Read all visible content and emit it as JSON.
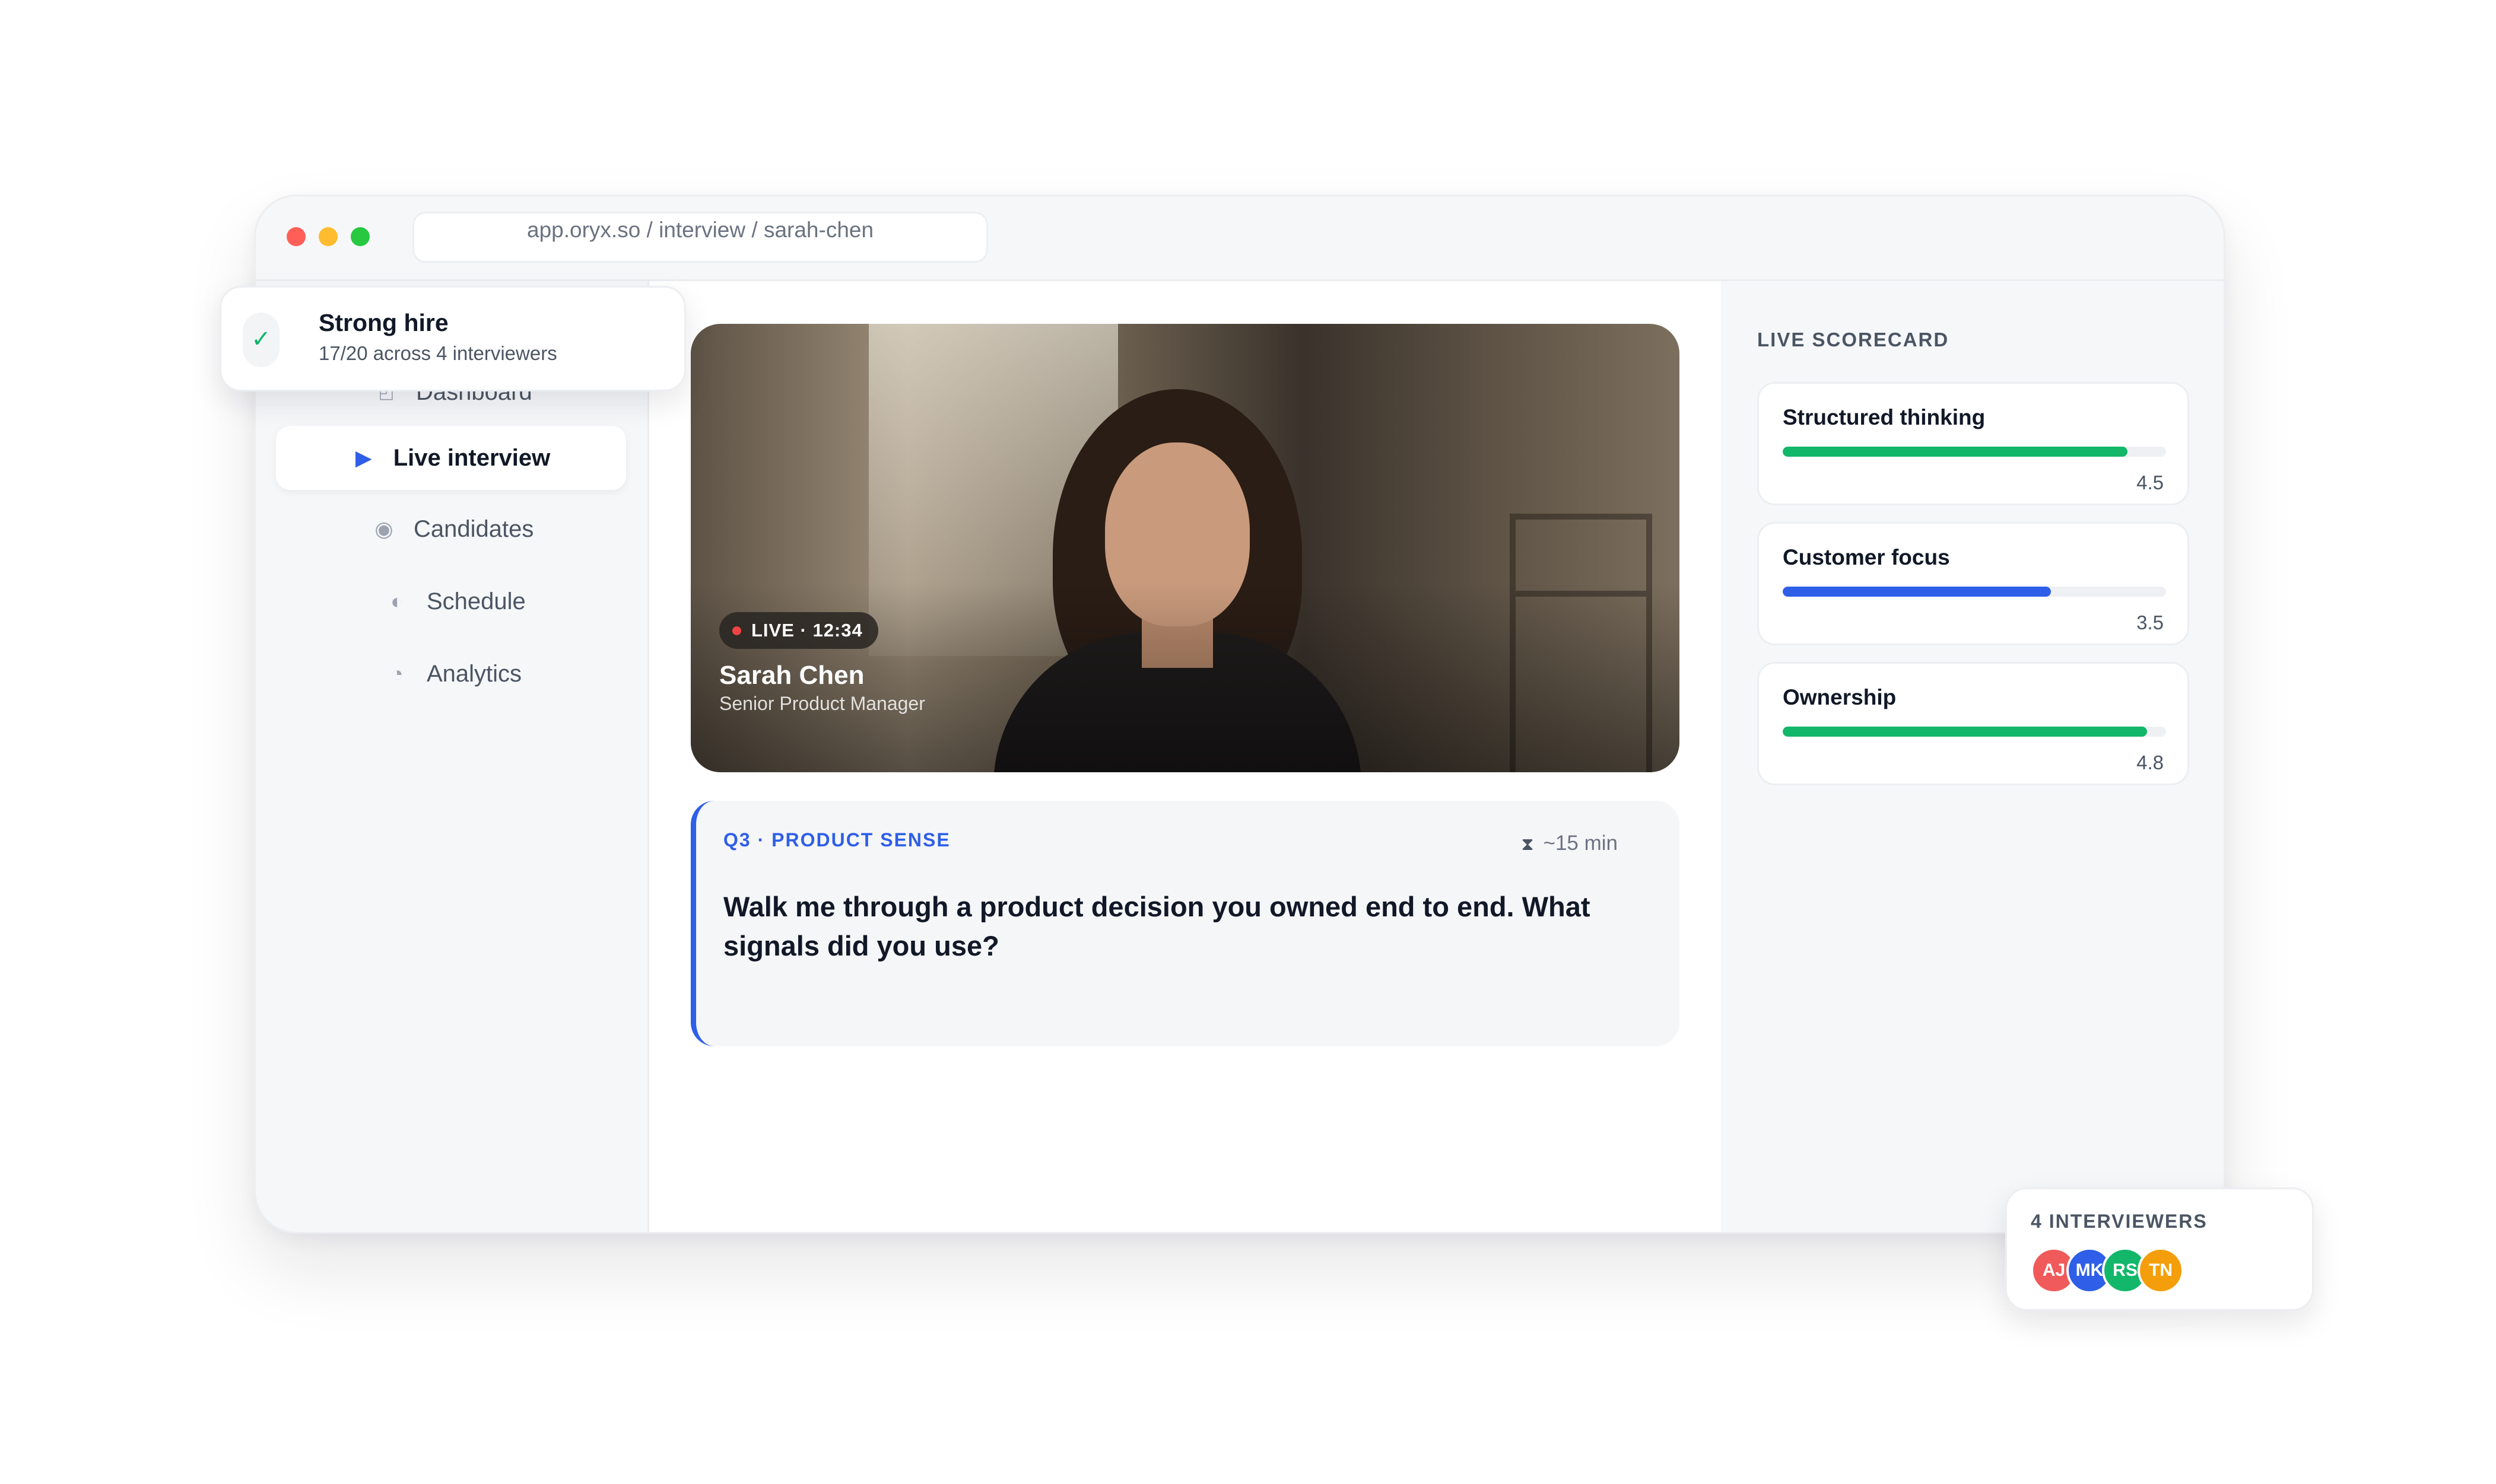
{
  "browser": {
    "url": "app.oryx.so / interview / sarah-chen"
  },
  "sidebar": {
    "items": [
      {
        "label": "Dashboard",
        "icon": "dashboard-icon"
      },
      {
        "label": "Live interview",
        "icon": "play-icon",
        "active": true
      },
      {
        "label": "Candidates",
        "icon": "candidates-icon"
      },
      {
        "label": "Schedule",
        "icon": "schedule-icon"
      },
      {
        "label": "Analytics",
        "icon": "analytics-icon"
      }
    ]
  },
  "video": {
    "live_badge": "LIVE · 12:34",
    "candidate_name": "Sarah Chen",
    "candidate_role": "Senior Product Manager"
  },
  "question": {
    "tag": "Q3 · PRODUCT SENSE",
    "duration": "~15 min",
    "text": "Walk me through a product decision you owned end to end. What signals did you use?"
  },
  "scorecard": {
    "title": "LIVE SCORECARD",
    "items": [
      {
        "label": "Structured thinking",
        "value": "4.5",
        "fraction": 0.9,
        "color": "#12b76a"
      },
      {
        "label": "Customer focus",
        "value": "3.5",
        "fraction": 0.7,
        "color": "#2f5fe8"
      },
      {
        "label": "Ownership",
        "value": "4.8",
        "fraction": 0.95,
        "color": "#12b76a"
      }
    ]
  },
  "hire_card": {
    "title": "Strong hire",
    "subtitle": "17/20 across 4 interviewers"
  },
  "interviewers": {
    "title": "4 INTERVIEWERS",
    "avatars": [
      {
        "initials": "AJ",
        "color": "#f05a5a"
      },
      {
        "initials": "MK",
        "color": "#2f5fe8"
      },
      {
        "initials": "RS",
        "color": "#12b76a"
      },
      {
        "initials": "TN",
        "color": "#f59e0b"
      }
    ]
  }
}
